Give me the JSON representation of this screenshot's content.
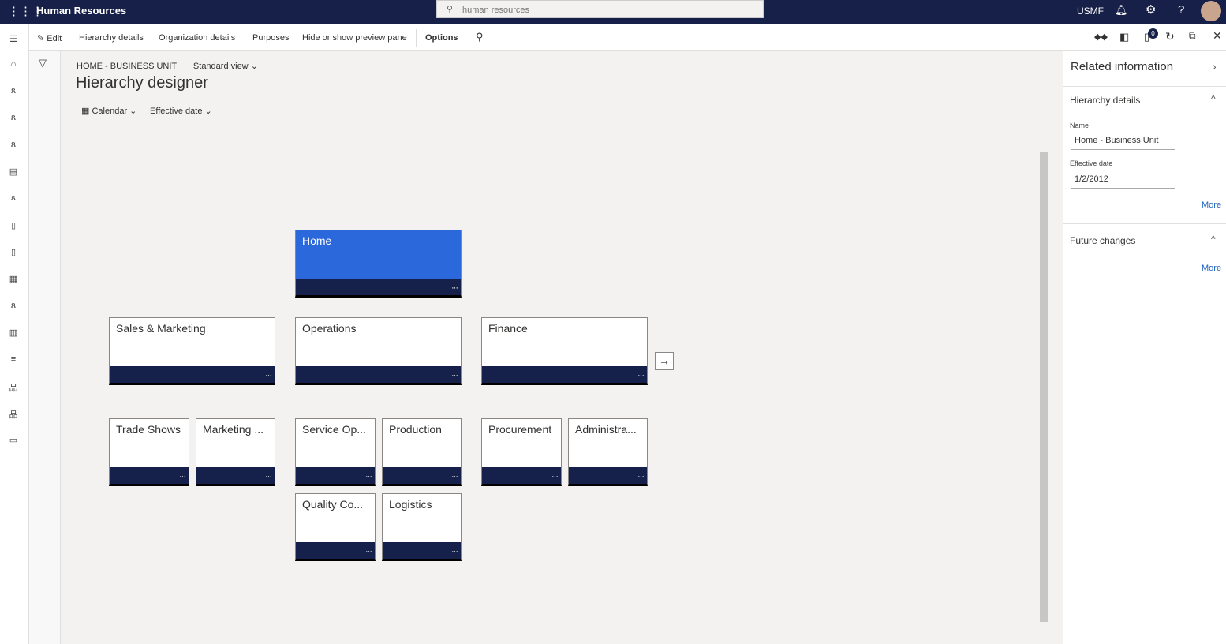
{
  "app": {
    "title": "Human Resources",
    "search_placeholder": "human resources",
    "company": "USMF"
  },
  "actions": {
    "edit": "Edit",
    "hierarchy_details": "Hierarchy details",
    "organization_details": "Organization details",
    "purposes": "Purposes",
    "hide_show": "Hide or show preview pane",
    "options": "Options",
    "badge": "0"
  },
  "page": {
    "breadcrumb": "HOME - BUSINESS UNIT",
    "separator": "|",
    "view": "Standard view",
    "title": "Hierarchy designer",
    "calendar": "Calendar",
    "effective_date": "Effective date"
  },
  "nodes": {
    "home": "Home",
    "sales": "Sales & Marketing",
    "operations": "Operations",
    "finance": "Finance",
    "trade": "Trade Shows",
    "marketing": "Marketing ...",
    "service": "Service Op...",
    "production": "Production",
    "procurement": "Procurement",
    "admin": "Administra...",
    "quality": "Quality Co...",
    "logistics": "Logistics",
    "dots": "···"
  },
  "pane": {
    "title": "Related information",
    "section1": "Hierarchy details",
    "name_label": "Name",
    "name_value": "Home - Business Unit",
    "date_label": "Effective date",
    "date_value": "1/2/2012",
    "more": "More",
    "section2": "Future changes"
  },
  "colors": {
    "topbar": "#172048",
    "selected": "#2b68dc",
    "band": "#15204b"
  }
}
